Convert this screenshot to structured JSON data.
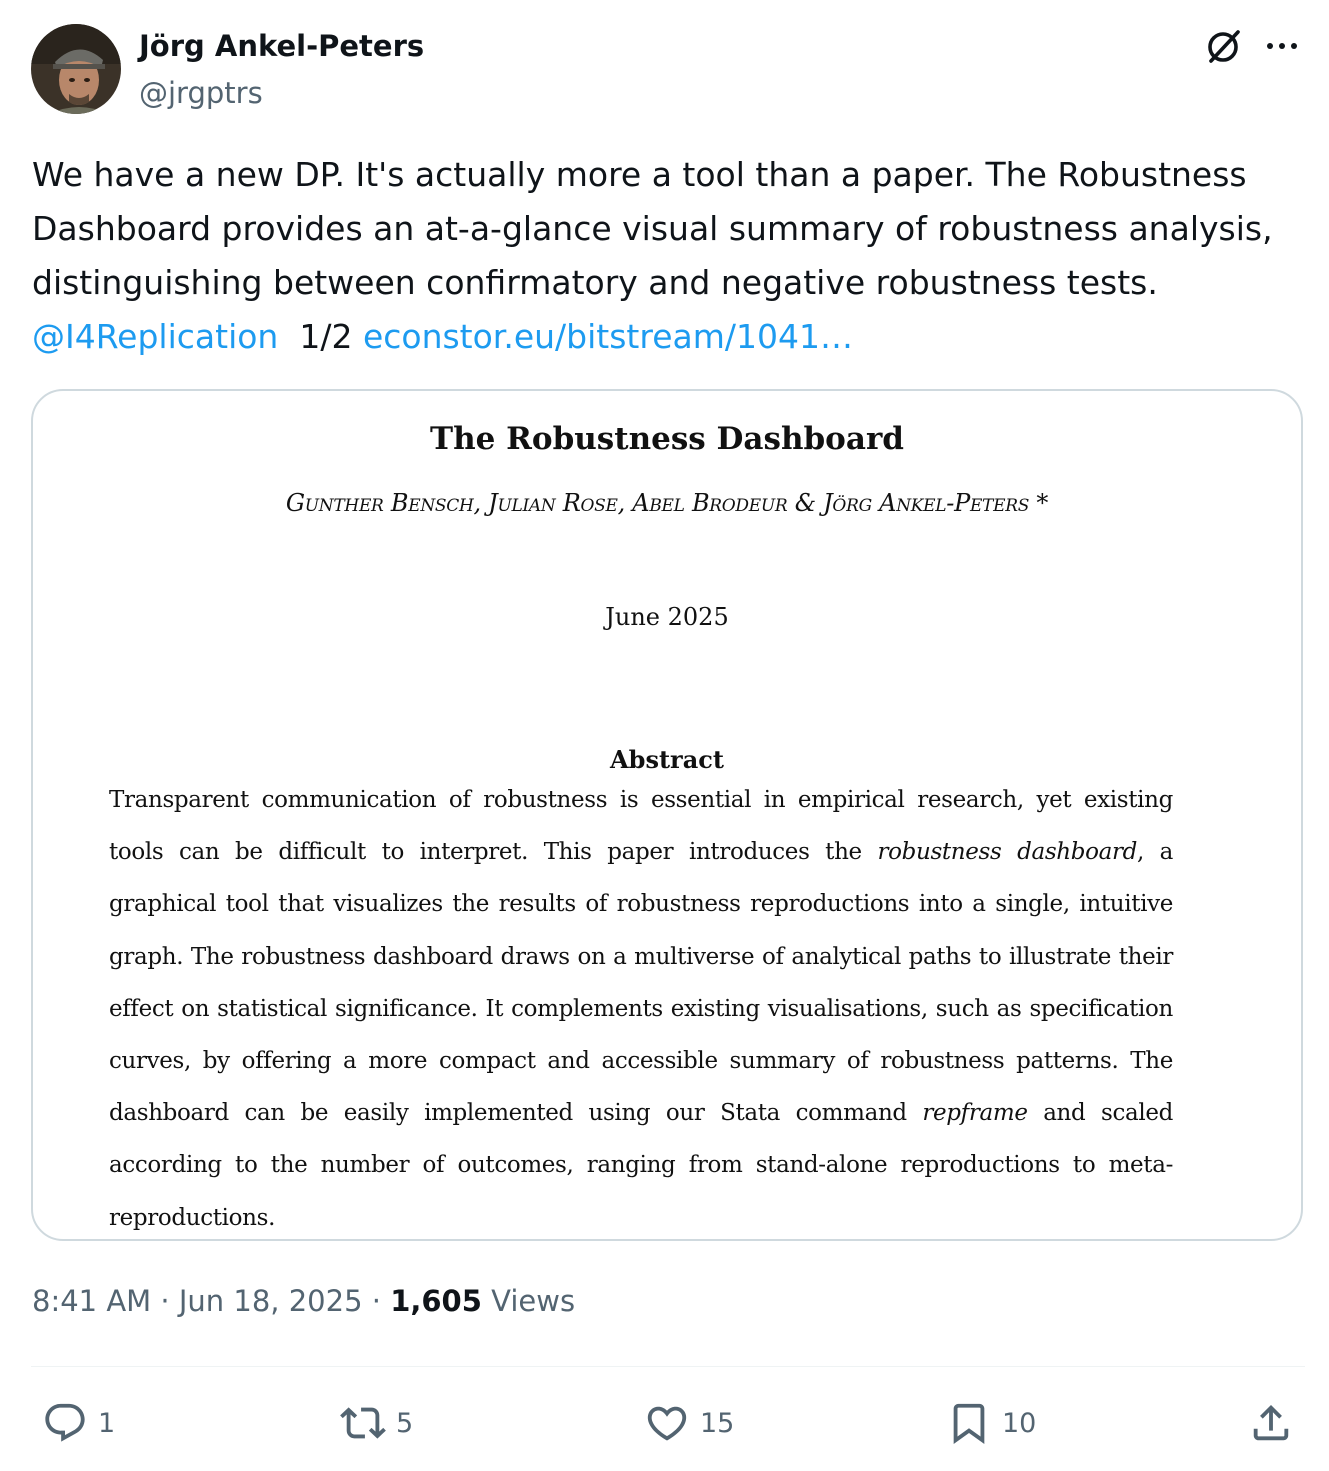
{
  "author": {
    "name": "Jörg Ankel-Peters",
    "handle": "@jrgptrs"
  },
  "header": {
    "grok_icon": "grok-icon",
    "more_icon": "more-icon"
  },
  "tweet": {
    "text": "We have a new DP. It's actually more a tool than a paper. The Robustness Dashboard provides an at-a-glance visual summary of robustness analysis, distinguishing between confirmatory and negative robustness tests.",
    "mention": "@I4Replication",
    "thread_marker": "1/2",
    "link": "econstor.eu/bitstream/1041…"
  },
  "card": {
    "title": "The Robustness Dashboard",
    "authors": "Gunther Bensch, Julian Rose, Abel Brodeur & Jörg Ankel-Peters *",
    "date": "June 2025",
    "abstract_heading": "Abstract",
    "abstract_part1": "Transparent communication of robustness is essential in empirical research, yet existing tools can be difficult to interpret. This paper introduces the ",
    "abstract_em1": "robustness dashboard",
    "abstract_part2": ", a graphical tool that visualizes the results of robustness reproductions into a single, intuitive graph. The robustness dashboard draws on a multiverse of analytical paths to illustrate their effect on statistical significance. It complements existing visualisations, such as specification curves, by offering a more compact and accessible summary of robustness patterns. The dashboard can be easily implemented using our Stata command ",
    "abstract_em2": "repframe",
    "abstract_part3": " and scaled according to the number of outcomes, ranging from stand-alone reproductions to meta-reproductions."
  },
  "meta": {
    "time": "8:41 AM",
    "date": "Jun 18, 2025",
    "views_count": "1,605",
    "views_label": "Views",
    "separator": "·"
  },
  "actions": {
    "replies": "1",
    "reposts": "5",
    "likes": "15",
    "bookmarks": "10"
  },
  "colors": {
    "link": "#1d9bf0",
    "secondary_text": "#536471",
    "primary_text": "#0f1419",
    "border": "#cfd9de"
  }
}
